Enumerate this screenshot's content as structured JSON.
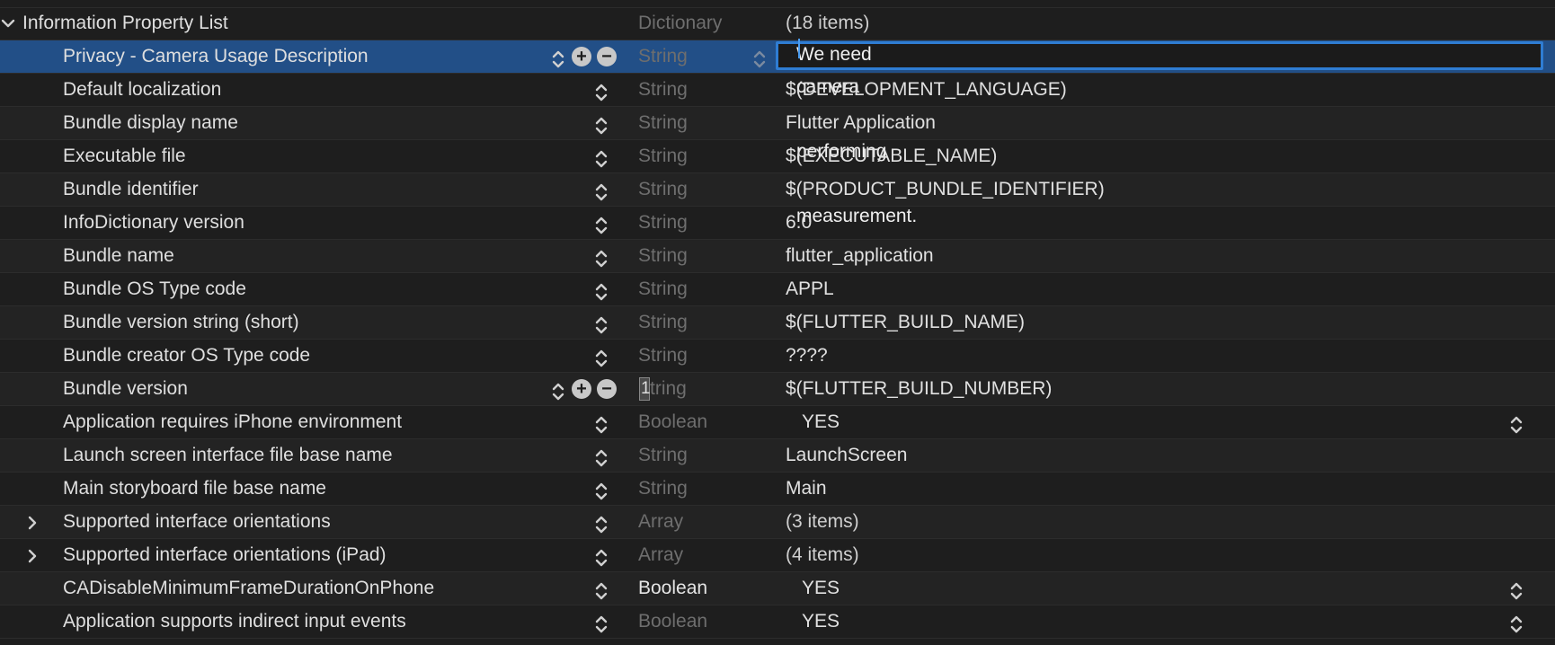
{
  "root": {
    "key": "Information Property List",
    "type": "Dictionary",
    "value": "(18 items)"
  },
  "rows": [
    {
      "key": "Privacy - Camera Usage Description",
      "type": "String",
      "value": "We need camera permission for performing the measurement."
    },
    {
      "key": "Default localization",
      "type": "String",
      "value": "$(DEVELOPMENT_LANGUAGE)"
    },
    {
      "key": "Bundle display name",
      "type": "String",
      "value": "Flutter Application"
    },
    {
      "key": "Executable file",
      "type": "String",
      "value": "$(EXECUTABLE_NAME)"
    },
    {
      "key": "Bundle identifier",
      "type": "String",
      "value": "$(PRODUCT_BUNDLE_IDENTIFIER)"
    },
    {
      "key": "InfoDictionary version",
      "type": "String",
      "value": "6.0"
    },
    {
      "key": "Bundle name",
      "type": "String",
      "value": "flutter_application"
    },
    {
      "key": "Bundle OS Type code",
      "type": "String",
      "value": "APPL"
    },
    {
      "key": "Bundle version string (short)",
      "type": "String",
      "value": "$(FLUTTER_BUILD_NAME)"
    },
    {
      "key": "Bundle creator OS Type code",
      "type": "String",
      "value": "????"
    },
    {
      "key": "Bundle version",
      "type": "tring",
      "type_caret_char": "1",
      "value": "$(FLUTTER_BUILD_NUMBER)"
    },
    {
      "key": "Application requires iPhone environment",
      "type": "Boolean",
      "value": "YES"
    },
    {
      "key": "Launch screen interface file base name",
      "type": "String",
      "value": "LaunchScreen"
    },
    {
      "key": "Main storyboard file base name",
      "type": "String",
      "value": "Main"
    },
    {
      "key": "Supported interface orientations",
      "type": "Array",
      "value": "(3 items)"
    },
    {
      "key": "Supported interface orientations (iPad)",
      "type": "Array",
      "value": "(4 items)"
    },
    {
      "key": "CADisableMinimumFrameDurationOnPhone",
      "type": "Boolean",
      "value": "YES"
    },
    {
      "key": "Application supports indirect input events",
      "type": "Boolean",
      "value": "YES"
    }
  ],
  "icons": {
    "disclosure_open": "chevron-down-icon",
    "disclosure_closed": "chevron-right-icon",
    "stepper": "up-down-chevron-icon",
    "add": "plus-circle-icon",
    "remove": "minus-circle-icon"
  },
  "colors": {
    "background": "#1e1e1e",
    "selection": "#224f87",
    "focus_ring": "#2f7dd3"
  }
}
